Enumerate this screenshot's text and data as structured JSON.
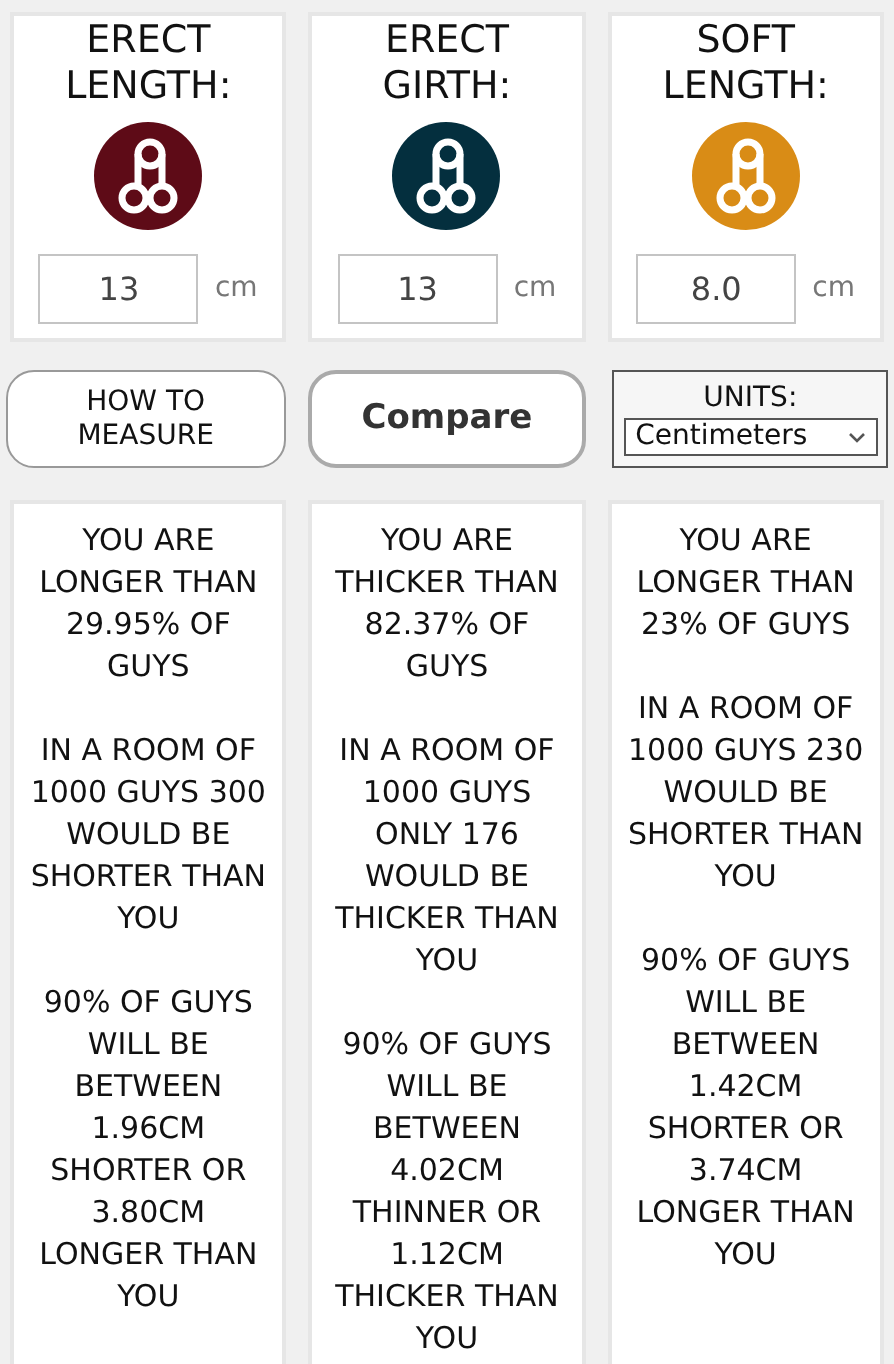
{
  "measures": [
    {
      "label": "ERECT LENGTH:",
      "color": "#5e0b17",
      "value": "13",
      "unit": "cm"
    },
    {
      "label": "ERECT GIRTH:",
      "color": "#042f3e",
      "value": "13",
      "unit": "cm"
    },
    {
      "label": "SOFT LENGTH:",
      "color": "#d98c16",
      "value": "8.0",
      "unit": "cm"
    }
  ],
  "how_to_button": "HOW TO MEASURE",
  "compare_button": "Compare",
  "units": {
    "label": "UNITS:",
    "value": "Centimeters"
  },
  "results": [
    {
      "paragraphs": [
        "YOU ARE LONGER THAN 29.95% OF GUYS",
        "IN A ROOM OF 1000 GUYS 300 WOULD BE SHORTER THAN YOU",
        "90% OF GUYS WILL BE BETWEEN 1.96CM SHORTER OR 3.80CM LONGER THAN YOU"
      ]
    },
    {
      "paragraphs": [
        "YOU ARE THICKER THAN 82.37% OF GUYS",
        "IN A ROOM OF 1000 GUYS ONLY 176 WOULD BE THICKER THAN YOU",
        "90% OF GUYS WILL BE BETWEEN 4.02CM THINNER OR 1.12CM THICKER THAN YOU"
      ]
    },
    {
      "paragraphs": [
        "YOU ARE LONGER THAN 23% OF GUYS",
        "IN A ROOM OF 1000 GUYS 230 WOULD BE SHORTER THAN YOU",
        "90% OF GUYS WILL BE BETWEEN 1.42CM SHORTER OR 3.74CM LONGER THAN YOU"
      ]
    }
  ]
}
